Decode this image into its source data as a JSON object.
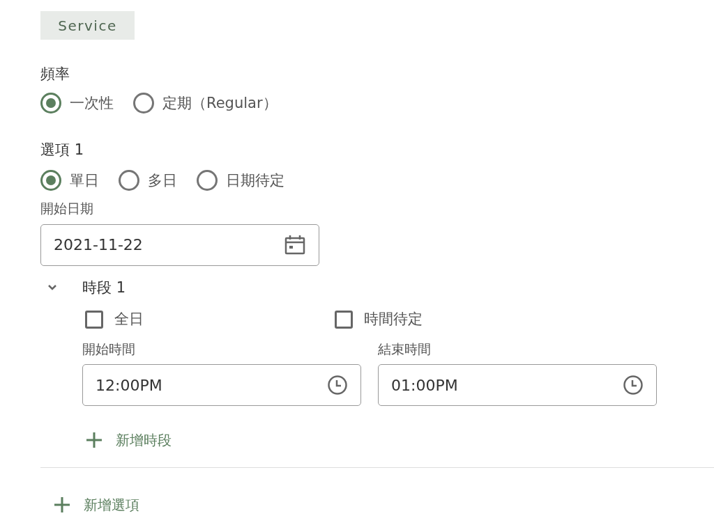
{
  "tag": "Service",
  "frequency": {
    "label": "頻率",
    "options": [
      {
        "label": "一次性",
        "selected": true
      },
      {
        "label": "定期（Regular）",
        "selected": false
      }
    ]
  },
  "option": {
    "title": "選項 1",
    "day_types": [
      {
        "label": "單日",
        "selected": true
      },
      {
        "label": "多日",
        "selected": false
      },
      {
        "label": "日期待定",
        "selected": false
      }
    ],
    "start_date": {
      "label": "開始日期",
      "value": "2021-11-22"
    },
    "time_slot": {
      "title": "時段 1",
      "expanded": true,
      "checkboxes": [
        {
          "label": "全日",
          "checked": false
        },
        {
          "label": "時間待定",
          "checked": false
        }
      ],
      "start_time": {
        "label": "開始時間",
        "value": "12:00PM"
      },
      "end_time": {
        "label": "結束時間",
        "value": "01:00PM"
      },
      "add_button": "新增時段"
    }
  },
  "add_option_button": "新增選項"
}
